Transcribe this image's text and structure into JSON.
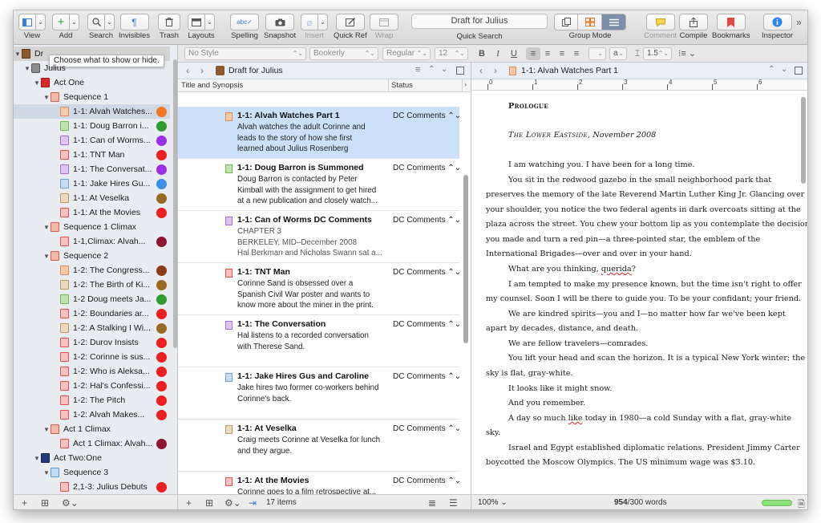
{
  "toolbar": {
    "view": "View",
    "add": "Add",
    "search": "Search",
    "invisibles": "Invisibles",
    "trash": "Trash",
    "layouts": "Layouts",
    "spelling": "Spelling",
    "snapshot": "Snapshot",
    "insert": "Insert",
    "quick_ref": "Quick Ref",
    "wrap": "Wrap",
    "quick_search_value": "Draft for Julius",
    "quick_search": "Quick Search",
    "group_mode": "Group Mode",
    "comment": "Comment",
    "compile": "Compile",
    "bookmarks": "Bookmarks",
    "inspector": "Inspector"
  },
  "format_bar": {
    "style": "No Style",
    "font": "Bookerly",
    "weight": "Regular",
    "size": "12",
    "bold": "B",
    "italic": "I",
    "underline": "U",
    "spacing_value": "a",
    "line_spacing": "1.5"
  },
  "binder": {
    "tooltip": "Choose what to show or hide.",
    "root_label": "Dr",
    "items": [
      {
        "label": "Julius"
      },
      {
        "label": "Act One"
      },
      {
        "label": "Sequence 1"
      },
      {
        "label": "1-1: Alvah Watches..."
      },
      {
        "label": "1-1: Doug Barron i..."
      },
      {
        "label": "1-1: Can of Worms..."
      },
      {
        "label": "1-1: TNT Man"
      },
      {
        "label": "1-1: The Conversat..."
      },
      {
        "label": "1-1: Jake Hires Gu..."
      },
      {
        "label": "1-1: At Veselka"
      },
      {
        "label": "1-1: At the Movies"
      },
      {
        "label": "Sequence 1 Climax"
      },
      {
        "label": "1-1,Climax: Alvah..."
      },
      {
        "label": "Sequence 2"
      },
      {
        "label": "1-2: The Congress..."
      },
      {
        "label": "1-2: The Birth of Ki..."
      },
      {
        "label": "1-2 Doug meets Ja..."
      },
      {
        "label": "1-2: Boundaries ar..."
      },
      {
        "label": "1-2: A Stalking I Wi..."
      },
      {
        "label": "1-2: Durov Insists"
      },
      {
        "label": "1-2: Corinne is sus..."
      },
      {
        "label": "1-2: Who is Aleksa..."
      },
      {
        "label": "1-2: Hal's Confessi..."
      },
      {
        "label": "1-2: The Pitch"
      },
      {
        "label": "1-2: Alvah Makes..."
      },
      {
        "label": "Act 1 Climax"
      },
      {
        "label": "Act 1 Climax: Alvah..."
      },
      {
        "label": "Act Two:One"
      },
      {
        "label": "Sequence 3"
      },
      {
        "label": "2,1-3: Julius Debuts"
      }
    ]
  },
  "outliner": {
    "header_title": "Draft for Julius",
    "col_title": "Title and Synopsis",
    "col_status": "Status",
    "rows": [
      {
        "title": "1-1: Alvah Watches Part 1",
        "synopsis": [
          "Alvah watches the adult Corinne and",
          "leads to the story of how she first",
          "learned about Julius Rosenberg"
        ],
        "status": "DC Comments"
      },
      {
        "title": "1-1: Doug Barron is Summoned",
        "synopsis": [
          "Doug Barron is contacted by Peter",
          "Kimball with the assignment to get hired",
          "at a new publication and closely watch..."
        ],
        "status": "DC Comments"
      },
      {
        "title": "1-1: Can of Worms DC Comments",
        "synopsis": [
          "CHAPTER 3",
          "BERKELEY, MID–December 2008",
          "Hal Berkman and Nicholas Swann sat a..."
        ],
        "status": "DC Comments"
      },
      {
        "title": "1-1: TNT Man",
        "synopsis": [
          " Corinne Sand is obsessed over a",
          "Spanish Civil War poster and wants to",
          "know more about the miner in the print."
        ],
        "status": "DC Comments"
      },
      {
        "title": "1-1: The Conversation",
        "synopsis": [
          "Hal listens to a recorded conversation",
          "with Therese Sand."
        ],
        "status": "DC Comments"
      },
      {
        "title": "1-1: Jake Hires Gus and Caroline",
        "synopsis": [
          "Jake hires two former co-workers behind",
          "Corinne's back."
        ],
        "status": "DC Comments"
      },
      {
        "title": "1-1: At Veselka",
        "synopsis": [
          " Craig meets Corinne at Veselka for lunch",
          "and they argue."
        ],
        "status": "DC Comments"
      },
      {
        "title": "1-1: At the Movies",
        "synopsis": [
          "Corinne goes to a film retrospective at..."
        ],
        "status": "DC Comments"
      }
    ],
    "item_count": "17 items"
  },
  "editor": {
    "header_title": "1-1: Alvah Watches Part 1",
    "ruler": [
      "0",
      "1",
      "2",
      "3",
      "4",
      "5",
      "6"
    ],
    "prologue": "Prologue",
    "dateline_place": "The Lower Eastside,",
    "dateline_date": " November 2008",
    "lines": [
      "I am watching you. I have been for a long time.",
      "You sit in the redwood gazebo in the small neighborhood park that",
      "preserves the memory of the late Reverend Martin Luther King Jr. Glancing over",
      "your shoulder, you notice the two federal agents in dark overcoats sitting at the",
      "plaza across the street. You chew your bottom lip as you contemplate the decision",
      "you made and turn a red pin—a three-pointed star, the emblem of the",
      "International Brigades—over and over in your hand.",
      "What are you thinking, ",
      "I am tempted to make my presence known, but the time isn't right to offer",
      "my counsel. Soon I will be there to guide you. To be your confidant; your friend.",
      "We are kindred spirits—you and I—no matter how far we've been kept",
      "apart by decades, distance, and death.",
      "We are fellow travelers—comrades.",
      "You lift your head and scan the horizon. It is a typical New York winter; the",
      "sky is flat, gray-white.",
      "It looks like it might snow.",
      "And you remember.",
      "A day so much ",
      "sky.",
      "Israel and Egypt established diplomatic relations. President Jimmy Carter",
      "boycotted the Moscow Olympics. The US minimum wage was $3.10."
    ],
    "querida": "querida",
    "querida_end": "?",
    "like_word": "like",
    "day_rest": " today in 1980—a cold Sunday with a flat, gray-white",
    "zoom": "100%",
    "word_count": "954",
    "word_target": "/300 words"
  },
  "colors": {
    "red": "#f01e1e",
    "green": "#2e9c2e",
    "purple": "#9b30e8",
    "orange": "#f4771f",
    "blue": "#3a8fe8",
    "brown": "#9a6a25",
    "darkred": "#8e1430",
    "rust": "#8d3a18"
  }
}
